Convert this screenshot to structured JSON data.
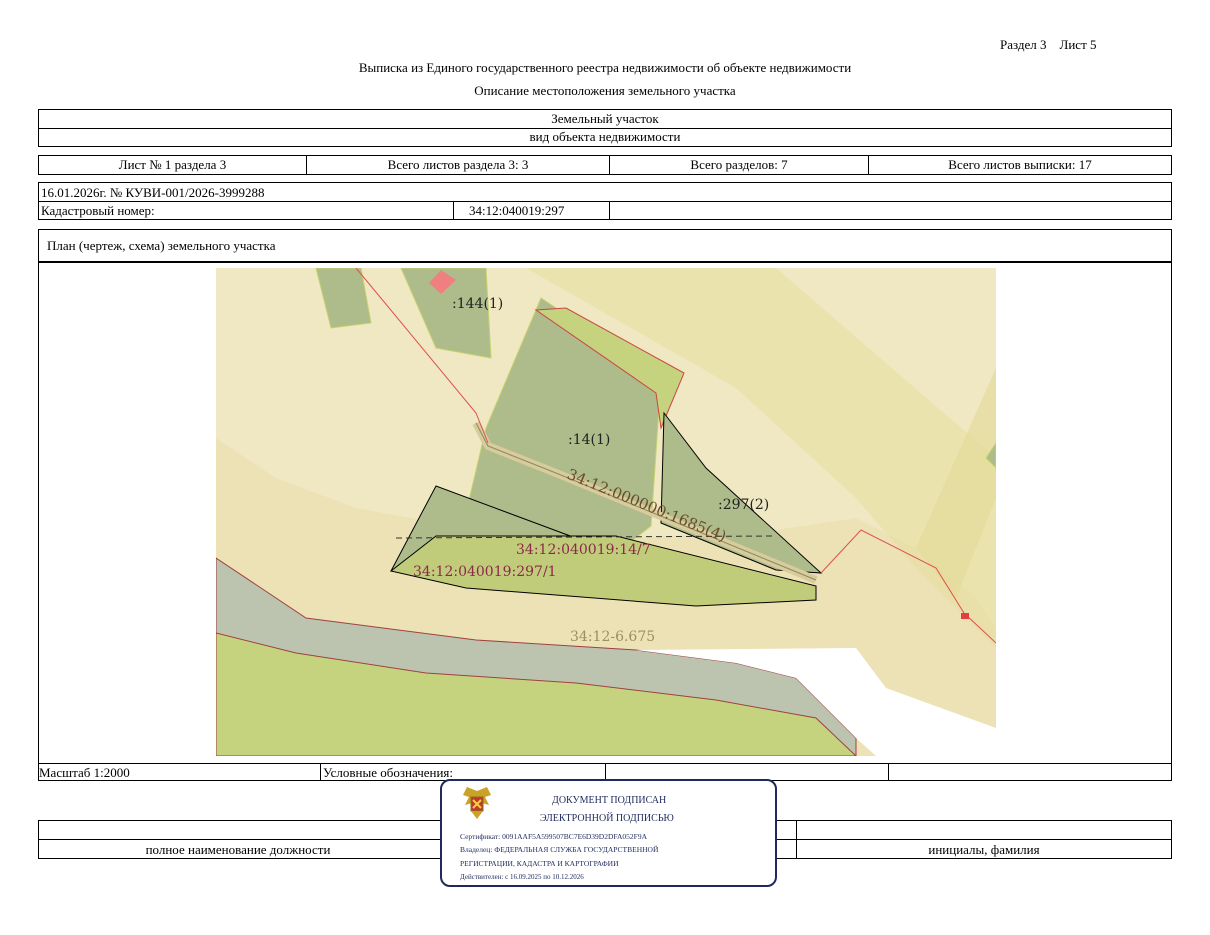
{
  "header": {
    "section_sheet": "Раздел 3    Лист 5",
    "title": "Выписка из Единого государственного реестра недвижимости об объекте недвижимости",
    "subtitle": "Описание местоположения земельного участка"
  },
  "object": {
    "type": "Земельный участок",
    "type_caption": "вид объекта недвижимости"
  },
  "sheet_info": {
    "sheet": "Лист № 1 раздела 3",
    "total_sheets_section": "Всего листов раздела 3: 3",
    "total_sections": "Всего разделов: 7",
    "total_sheets_extract": "Всего листов выписки: 17"
  },
  "record": {
    "date_number": "16.01.2026г. № КУВИ-001/2026-3999288",
    "cadastral_label": "Кадастровый номер:",
    "cadastral_number": "34:12:040019:297"
  },
  "plan": {
    "title": "План (чертеж, схема) земельного участка",
    "labels": {
      "parcel_144": ":144(1)",
      "parcel_14": ":14(1)",
      "parcel_297": ":297(2)",
      "road": "34:12:000000:1685(4)",
      "sub_14_7": "34:12:040019:14/7",
      "sub_297_1": "34:12:040019:297/1",
      "zone": "34:12-6.675"
    }
  },
  "footer": {
    "scale": "Масштаб 1:2000",
    "legend": "Условные обозначения:",
    "position_caption": "полное наименование должности",
    "name_caption": "инициалы, фамилия"
  },
  "stamp": {
    "line1": "ДОКУМЕНТ ПОДПИСАН",
    "line2": "ЭЛЕКТРОННОЙ ПОДПИСЬЮ",
    "certificate": "Сертификат: 0091AAF5A599507BC7E6D39D2DFA052F9A",
    "owner1": "Владелец: ФЕДЕРАЛЬНАЯ СЛУЖБА ГОСУДАРСТВЕННОЙ",
    "owner2": "РЕГИСТРАЦИИ, КАДАСТРА И КАРТОГРАФИИ",
    "valid": "Действителен: с 16.09.2025 по 10.12.2026"
  }
}
